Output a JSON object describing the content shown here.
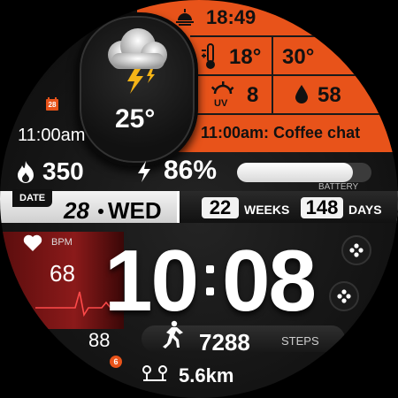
{
  "weather": {
    "temp": "25°",
    "condition_icon": "thunderstorm-cloud-icon",
    "sunrise_time": "18:49",
    "temp_low": "18°",
    "temp_high": "30°",
    "uv_index": "8",
    "humidity": "58",
    "event": "11:00am: Coffee chat"
  },
  "calendar": {
    "day_badge": "28",
    "next_time": "11:00am"
  },
  "activity": {
    "calories": "350",
    "steps": "7288",
    "steps_label": "STEPS",
    "distance": "5.6km",
    "floors": "88",
    "floors_badge": "6"
  },
  "battery": {
    "percent_label": "86%",
    "percent": 86,
    "label": "BATTERY"
  },
  "date": {
    "label": "DATE",
    "day": "28",
    "weekday": "WED",
    "weeks": "22",
    "weeks_label": "WEEKS",
    "days": "148",
    "days_label": "DAYS"
  },
  "heart": {
    "bpm_label": "BPM",
    "bpm": "68"
  },
  "time": {
    "hours": "10",
    "minutes": "08"
  },
  "colors": {
    "accent": "#e8531a",
    "heart": "#8b1a1a"
  }
}
